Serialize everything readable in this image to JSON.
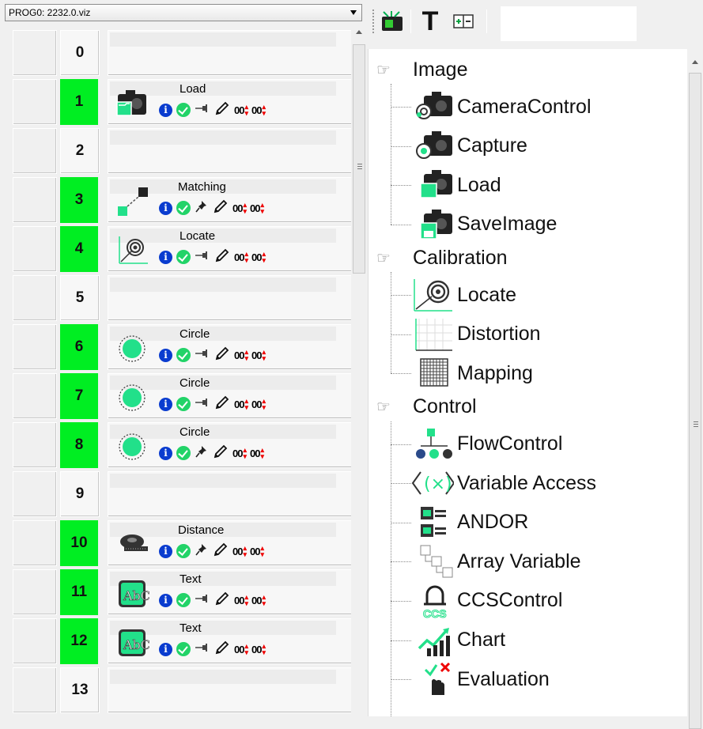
{
  "program_select": {
    "value": "PROG0: 2232.0.viz"
  },
  "grid": {
    "rows": [
      {
        "num": "0",
        "green": false,
        "tool": "",
        "icon": ""
      },
      {
        "num": "1",
        "green": true,
        "tool": "Load",
        "icon": "load-image-icon",
        "pin": "pin"
      },
      {
        "num": "2",
        "green": false,
        "tool": "",
        "icon": ""
      },
      {
        "num": "3",
        "green": true,
        "tool": "Matching",
        "icon": "matching-icon",
        "pin": "pushpin"
      },
      {
        "num": "4",
        "green": true,
        "tool": "Locate",
        "icon": "locate-icon",
        "pin": "pin"
      },
      {
        "num": "5",
        "green": false,
        "tool": "",
        "icon": ""
      },
      {
        "num": "6",
        "green": true,
        "tool": "Circle",
        "icon": "circle-icon",
        "pin": "pin"
      },
      {
        "num": "7",
        "green": true,
        "tool": "Circle",
        "icon": "circle-icon",
        "pin": "pin"
      },
      {
        "num": "8",
        "green": true,
        "tool": "Circle",
        "icon": "circle-icon",
        "pin": "pushpin"
      },
      {
        "num": "9",
        "green": false,
        "tool": "",
        "icon": ""
      },
      {
        "num": "10",
        "green": true,
        "tool": "Distance",
        "icon": "distance-icon",
        "pin": "pushpin"
      },
      {
        "num": "11",
        "green": true,
        "tool": "Text",
        "icon": "text-ocr-icon",
        "pin": "pin"
      },
      {
        "num": "12",
        "green": true,
        "tool": "Text",
        "icon": "text-ocr-icon",
        "pin": "pin"
      },
      {
        "num": "13",
        "green": false,
        "tool": "",
        "icon": ""
      }
    ],
    "status_icons": {
      "info": "i",
      "counter_a": "00",
      "counter_b": "00"
    }
  },
  "toolbar": {
    "buttons": [
      {
        "name": "add-tool-button",
        "icon": "add-tool-icon"
      },
      {
        "name": "text-button",
        "icon": "text-icon",
        "label": "T"
      },
      {
        "name": "insert-row-button",
        "icon": "insert-row-icon"
      }
    ],
    "field_value": ""
  },
  "tree": {
    "categories": [
      {
        "label": "Image",
        "items": [
          "CameraControl",
          "Capture",
          "Load",
          "SaveImage"
        ]
      },
      {
        "label": "Calibration",
        "items": [
          "Locate",
          "Distortion",
          "Mapping"
        ]
      },
      {
        "label": "Control",
        "items": [
          "FlowControl",
          "Variable Access",
          "ANDOR",
          "Array Variable",
          "CCSControl",
          "Chart",
          "Evaluation"
        ]
      }
    ]
  },
  "colors": {
    "green": "#00ee22",
    "info_blue": "#0a3ccf",
    "check_green": "#22d368",
    "tool_green": "#22e08a"
  }
}
